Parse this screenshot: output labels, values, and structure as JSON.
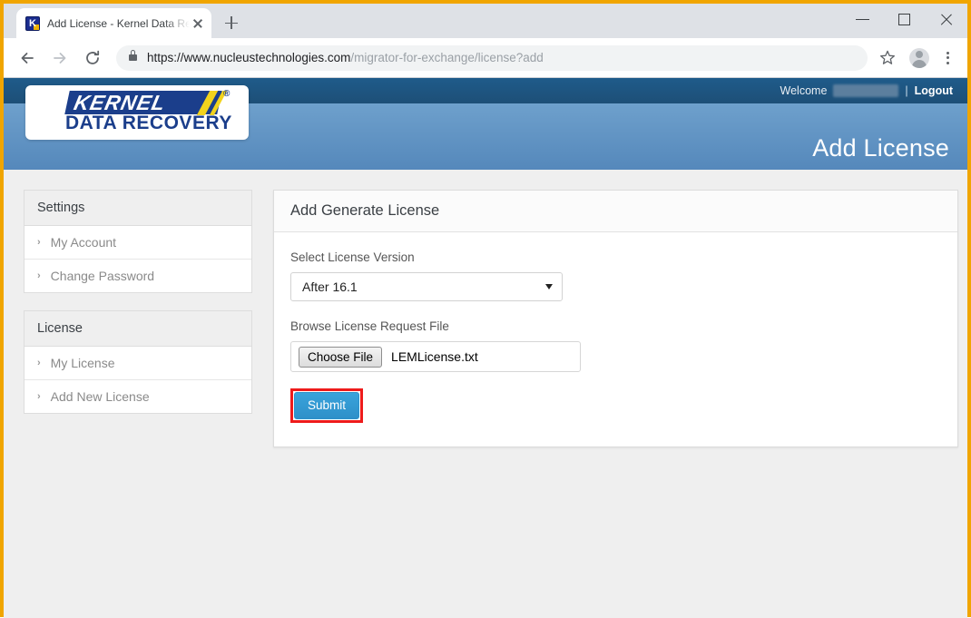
{
  "browser": {
    "tab": {
      "title": "Add License - Kernel Data Recove",
      "favicon": "kernel-favicon"
    },
    "new_tab_label": "+",
    "window_controls": {
      "minimize": "minimize-icon",
      "maximize": "maximize-icon",
      "close": "close-icon"
    },
    "toolbar": {
      "back": "back-arrow-icon",
      "forward": "forward-arrow-icon",
      "reload": "reload-icon",
      "lock": "lock-icon",
      "url_scheme_host": "https://www.nucleustechnologies.com",
      "url_path": "/migrator-for-exchange/license?add",
      "bookmark": "star-icon",
      "profile": "profile-avatar-icon",
      "menu": "kebab-menu-icon"
    }
  },
  "site": {
    "topbar": {
      "welcome_label": "Welcome",
      "username_redacted": "",
      "separator": "|",
      "logout_label": "Logout"
    },
    "logo": {
      "primary": "KERNEL",
      "registered": "®",
      "secondary": "DATA RECOVERY"
    },
    "page_title": "Add License"
  },
  "sidebar": {
    "panels": [
      {
        "heading": "Settings",
        "items": [
          {
            "label": "My Account"
          },
          {
            "label": "Change Password"
          }
        ]
      },
      {
        "heading": "License",
        "items": [
          {
            "label": "My License"
          },
          {
            "label": "Add New License"
          }
        ]
      }
    ],
    "bullet": "›"
  },
  "main": {
    "card_title": "Add Generate License",
    "version_label": "Select License Version",
    "version_value": "After 16.1",
    "browse_label": "Browse License Request File",
    "choose_file_label": "Choose File",
    "file_name": "LEMLicense.txt",
    "submit_label": "Submit"
  },
  "colors": {
    "window_border": "#f0a500",
    "topbar": "#1f5b8a",
    "banner": "#5e93c5",
    "submit": "#2e90c9",
    "highlight": "#ee1b1b",
    "logo_blue": "#1b3e8b",
    "logo_yellow": "#f2d31c"
  }
}
